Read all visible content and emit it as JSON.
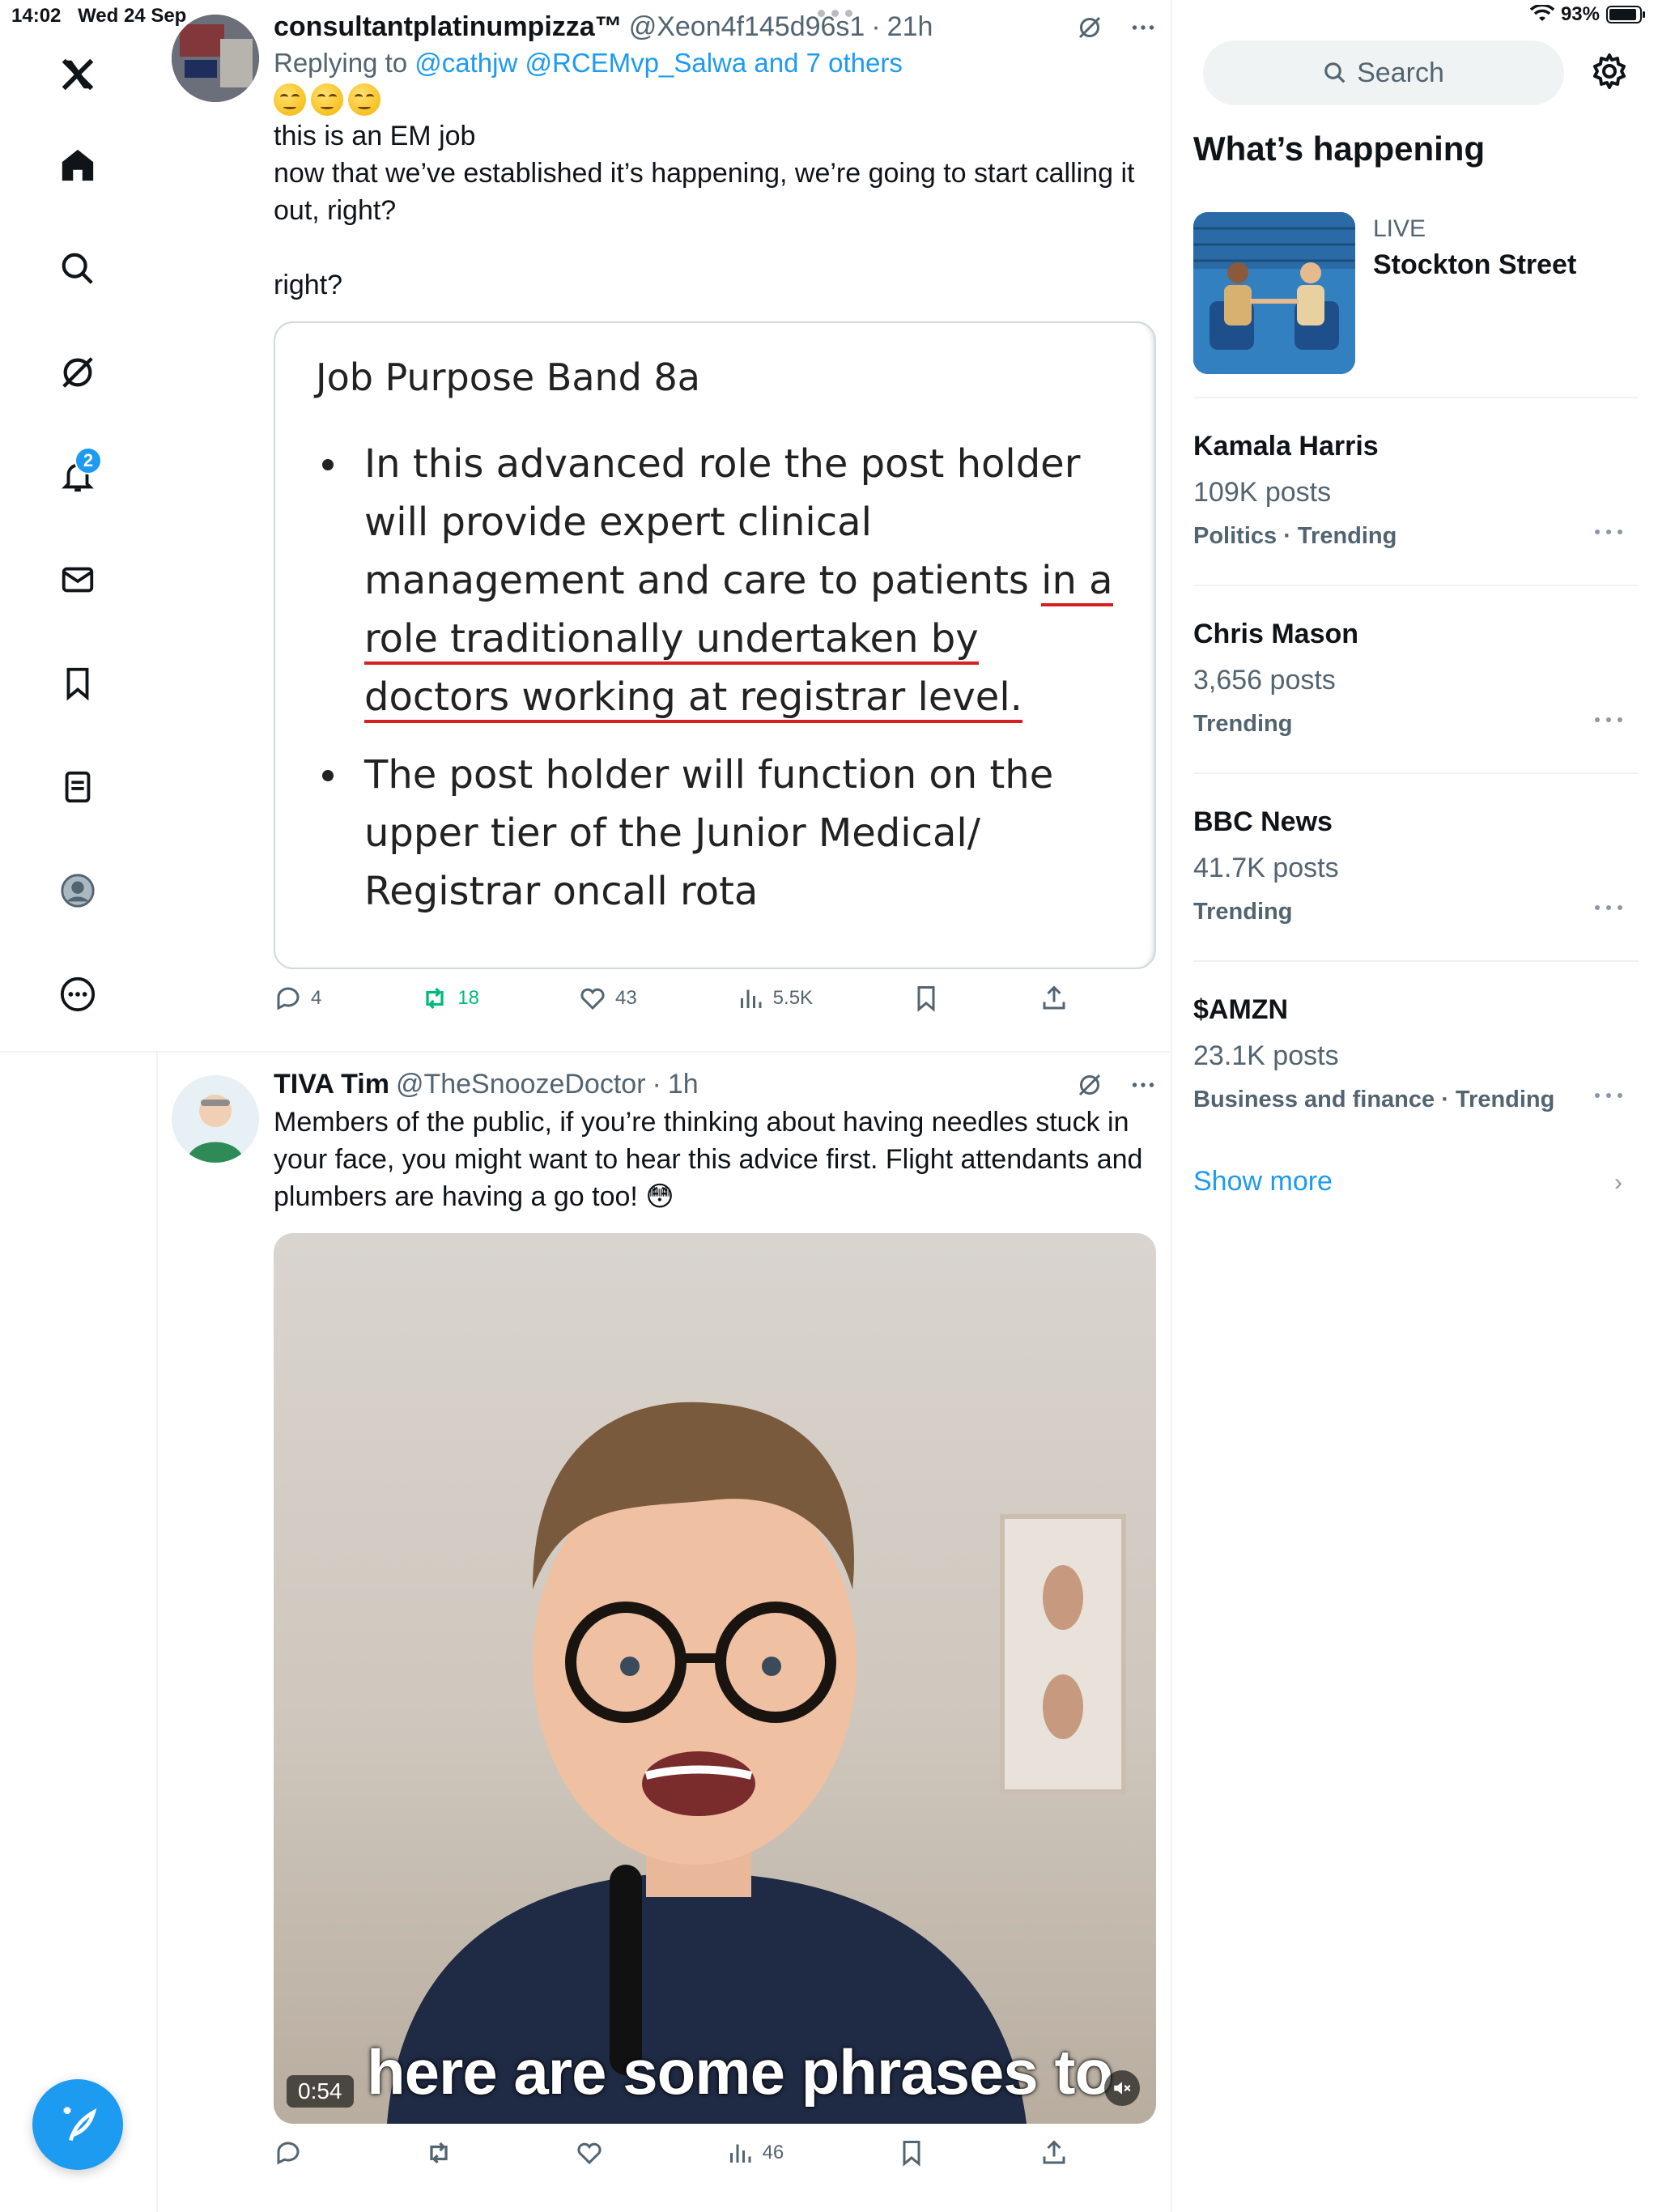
{
  "status": {
    "time": "14:02",
    "date": "Wed 24 Sep",
    "battery": "93%",
    "battery_level": 0.93
  },
  "nav": {
    "notifications_badge": "2"
  },
  "feed": {
    "post1": {
      "name": "consultantplatinumpizza™",
      "handle": "@Xeon4f145d96s1",
      "sep": "·",
      "time": "21h",
      "replying_prefix": "Replying to",
      "replying_to": "@cathjw @RCEMvp_Salwa and 7 others",
      "text": "this is an EM job\nnow that we’ve established it’s happening, we’re going to start calling it out, right?\n\nright?",
      "doc": {
        "title": "Job Purpose Band 8a",
        "bullet1_a": "In this advanced role the post holder will provide expert clinical management and care to patients ",
        "bullet1_b": "in a role traditionally undertaken by doctors working at registrar level.",
        "bullet2": "The post holder will function on the upper tier of the Junior Medical/ Registrar oncall rota"
      },
      "stats": {
        "replies": "4",
        "reposts": "18",
        "likes": "43",
        "views": "5.5K"
      }
    },
    "post2": {
      "name": "TIVA Tim",
      "handle": "@TheSnoozeDoctor",
      "sep": "·",
      "time": "1h",
      "text": "Members of the public, if you’re thinking about having needles stuck in your face, you might want to hear this advice first. Flight attendants and plumbers are having a go too! 😳",
      "video": {
        "duration": "0:54",
        "caption": "here are some phrases to"
      },
      "stats": {
        "replies": "",
        "reposts": "",
        "likes": "",
        "views": "46"
      }
    }
  },
  "sidebar": {
    "search_placeholder": "Search",
    "section_title": "What’s happening",
    "live": {
      "label": "LIVE",
      "title": "Stockton Street"
    },
    "trends": [
      {
        "name": "Kamala Harris",
        "count": "109K posts",
        "meta": "Politics · Trending"
      },
      {
        "name": "Chris Mason",
        "count": "3,656 posts",
        "meta": "Trending"
      },
      {
        "name": "BBC News",
        "count": "41.7K posts",
        "meta": "Trending"
      },
      {
        "name": "$AMZN",
        "count": "23.1K posts",
        "meta": "Business and finance · Trending"
      }
    ],
    "show_more": "Show more"
  },
  "colors": {
    "accent": "#1d9bf0",
    "repost": "#00ba7c",
    "muted": "#536471",
    "underline": "#d82020"
  }
}
